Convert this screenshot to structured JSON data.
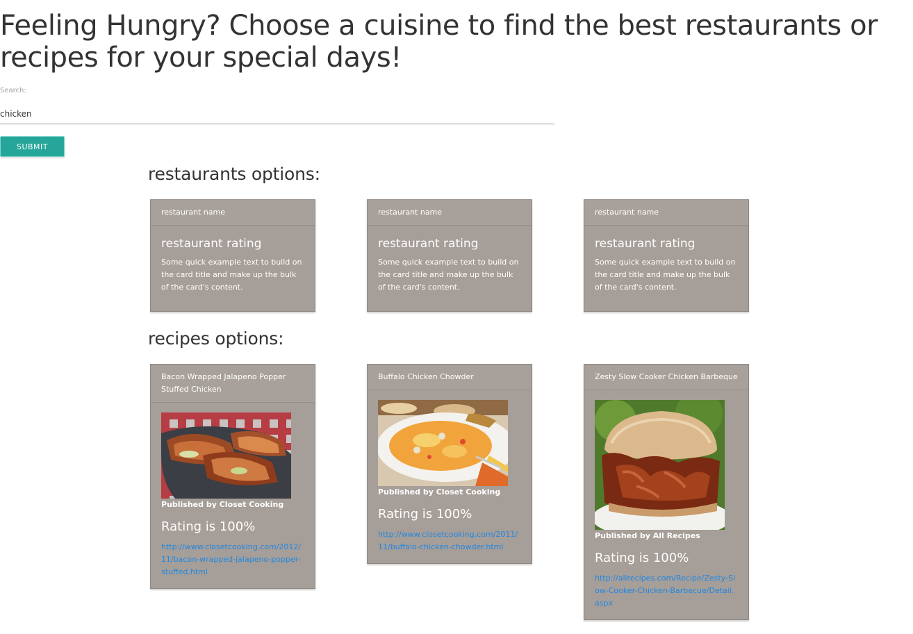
{
  "hero": {
    "title": "Feeling Hungry? Choose a cuisine to find the best restaurants or recipes for your special days!"
  },
  "search": {
    "label": "Search:",
    "value": "chicken"
  },
  "submit": {
    "label": "Submit"
  },
  "restaurants": {
    "heading": "restaurants options:",
    "cards": [
      {
        "name": "restaurant name",
        "rating": "restaurant rating",
        "text": "Some quick example text to build on the card title and make up the bulk of the card's content."
      },
      {
        "name": "restaurant name",
        "rating": "restaurant rating",
        "text": "Some quick example text to build on the card title and make up the bulk of the card's content."
      },
      {
        "name": "restaurant name",
        "rating": "restaurant rating",
        "text": "Some quick example text to build on the card title and make up the bulk of the card's content."
      }
    ]
  },
  "recipes": {
    "heading": "recipes options:",
    "cards": [
      {
        "title": "Bacon Wrapped Jalapeno Popper Stuffed Chicken",
        "image": "bacon-wrapped-chicken-photo",
        "publisher": "Published by Closet Cooking",
        "rating": "Rating is 100%",
        "url": "http://www.closetcooking.com/2012/11/bacon-wrapped-jalapeno-popper-stuffed.html"
      },
      {
        "title": "Buffalo Chicken Chowder",
        "image": "buffalo-chicken-chowder-photo",
        "publisher": "Published by Closet Cooking",
        "rating": "Rating is 100%",
        "url": "http://www.closetcooking.com/2011/11/buffalo-chicken-chowder.html"
      },
      {
        "title": "Zesty Slow Cooker Chicken Barbeque",
        "image": "bbq-chicken-sandwich-photo",
        "publisher": "Published by All Recipes",
        "rating": "Rating is 100%",
        "url": "http://allrecipes.com/Recipe/Zesty-Slow-Cooker-Chicken-Barbecue/Detail.aspx"
      }
    ]
  },
  "colors": {
    "submit": "#26a69a",
    "card": "#a69e98",
    "link": "#1e88e5"
  }
}
